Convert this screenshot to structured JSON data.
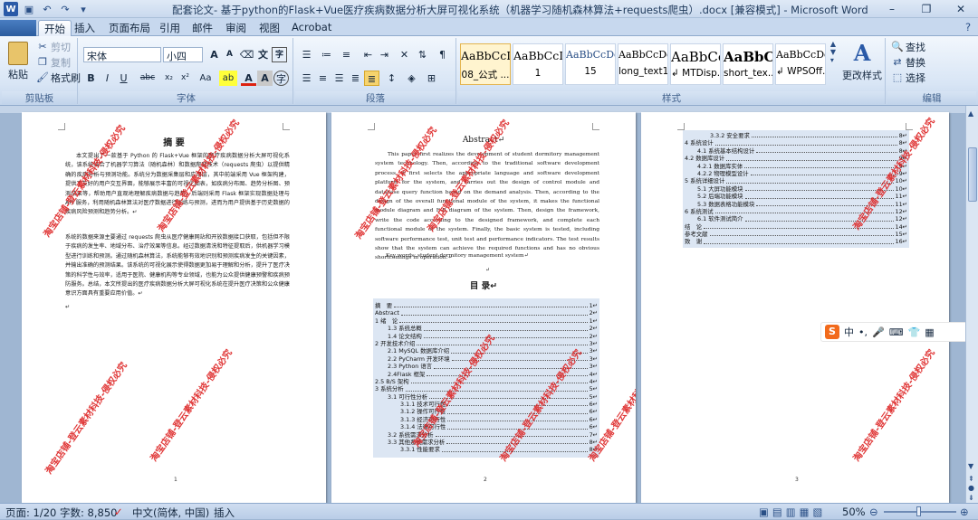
{
  "window": {
    "title": "配套论文- 基于python的Flask+Vue医疗疾病数据分析大屏可视化系统（机器学习随机森林算法+requests爬虫）.docx [兼容模式] - Microsoft Word",
    "minimize": "–",
    "restore": "❐",
    "close": "✕"
  },
  "qat": {
    "undo": "↶",
    "redo": "↷",
    "save": "💾",
    "more": "▾"
  },
  "tabs": [
    "开始",
    "插入",
    "页面布局",
    "引用",
    "邮件",
    "审阅",
    "视图",
    "Acrobat"
  ],
  "clipboard": {
    "paste": "粘贴",
    "cut": "剪切",
    "copy": "复制",
    "painter": "格式刷",
    "label": "剪贴板"
  },
  "font": {
    "name": "宋体",
    "size": "小四",
    "grow": "A",
    "shrink": "A",
    "label": "字体",
    "b": "B",
    "i": "I",
    "u": "U",
    "abc": "abc",
    "x2": "x²",
    "x_2": "x₂",
    "aa": "Aa",
    "hl": "ab",
    "fc": "A",
    "wen": "文",
    "a_circle": "A",
    "zi": "字"
  },
  "paragraph": {
    "label": "段落"
  },
  "styles": {
    "label": "样式",
    "items": [
      {
        "preview": "AaBbCcI",
        "name": "08_公式 ..."
      },
      {
        "preview": "AaBbCcI",
        "name": "1"
      },
      {
        "preview": "AaBbCcDdI",
        "name": "15"
      },
      {
        "preview": "AaBbCcDd",
        "name": "long_text1"
      },
      {
        "preview": "AaBbCc",
        "name": "↲ MTDisp..."
      },
      {
        "preview": "AaBbC",
        "name": "short_tex..."
      },
      {
        "preview": "AaBbCcDd",
        "name": "↲ WPSOff..."
      }
    ],
    "change": "更改样式"
  },
  "editing": {
    "find": "查找",
    "replace": "替换",
    "select": "选择",
    "label": "编辑"
  },
  "page1": {
    "heading": "摘  要",
    "para1": "本文提出了一款基于 Python 的 Flask+Vue 框架的医疗疾病数据分析大屏可视化系统，该系统结合了机器学习算法（随机森林）和数据爬取技术（requests 爬虫）以提供精确的疾病分析与预测功能。系统分为数据采集层和应用层，其中前端采用 Vue 框架构建，提供了友好的用户交互界面，能够展示丰富的可视化图表，如疾病分布图、趋势分析图、预测结果等，帮助用户直观地理解疾病数据与趋势。后端则采用 Flask 框架实现数据处理与 API 服务，利用随机森林算法对医疗数据进行训练与预测，进而为用户提供基于历史数据的疾病风险预测和趋势分析。↵",
    "para2": "系统的数据来源主要通过 requests 爬虫从医疗健康网站和开放数据接口获取，包括但不限于疾病的发生率、地域分布、治疗效果等信息。经过数据清洗和特征提取后，供机器学习模型进行训练和预测。通过随机森林算法，系统能够有效地识别和预测疾病发生的关键因素，并输出准确的预测结果。该系统的可视化展示使得数据更加易于理解和分析，提升了医疗决策的科学性与效率，适用于医院、健康机构等专业领域，也能为公众提供健康预警和疾病预防服务。总结，本文所提出的医疗疾病数据分析大屏可视化系统在提升医疗决策和公众健康意识方面具有重要应用价值。↵",
    "para3": "↵",
    "footer": "1"
  },
  "page2": {
    "heading": "Abstract↵",
    "body": "This paper first realizes the development of student dormitory management system technology. Then, according to the traditional software development process, it first selects the appropriate language and software development platform for the system, and carries out the design of control module and database query function based on the demand analysis. Then, according to the design of the overall functional module of the system, it makes the functional module diagram and E-R diagram of the system. Then, design the framework, write the code according to the designed framework, and complete each functional module of the system. Finally, the basic system is tested, including software performance test, unit test and performance indicators. The test results show that the system can achieve the required functions and has no obvious shortcomings in operation.↵",
    "keywords": "Key words: student dormitory management system↵",
    "blank": "↵",
    "toc_title": "目  录↵",
    "toc": [
      {
        "t": "摘　要",
        "n": "1",
        "i": 0
      },
      {
        "t": "Abstract",
        "n": "2",
        "i": 0
      },
      {
        "t": "1 绪　论",
        "n": "1",
        "i": 0
      },
      {
        "t": "1.3 系统总概",
        "n": "2",
        "i": 1
      },
      {
        "t": "1.4 论文结构",
        "n": "2",
        "i": 1
      },
      {
        "t": "2 开发技术介绍",
        "n": "3",
        "i": 0
      },
      {
        "t": "2.1 MySQL 数据库介绍",
        "n": "3",
        "i": 1
      },
      {
        "t": "2.2 PyCharm 开发环境",
        "n": "3",
        "i": 1
      },
      {
        "t": "2.3 Python 语言",
        "n": "3",
        "i": 1
      },
      {
        "t": "2.4Flask 框架",
        "n": "4",
        "i": 1
      },
      {
        "t": "2.5 B/S 架构",
        "n": "4",
        "i": 0
      },
      {
        "t": "3 系统分析",
        "n": "5",
        "i": 0
      },
      {
        "t": "3.1 可行性分析",
        "n": "5",
        "i": 1
      },
      {
        "t": "3.1.1 技术可行性",
        "n": "6",
        "i": 2
      },
      {
        "t": "3.1.2 操作可行性",
        "n": "6",
        "i": 2
      },
      {
        "t": "3.1.3 经济可行性",
        "n": "6",
        "i": 2
      },
      {
        "t": "3.1.4 法律可行性",
        "n": "6",
        "i": 2
      },
      {
        "t": "3.2 系统需求分析",
        "n": "7",
        "i": 1
      },
      {
        "t": "3.3 其他系统需求分析",
        "n": "8",
        "i": 1
      },
      {
        "t": "3.3.1 性能要求",
        "n": "8",
        "i": 2
      }
    ],
    "footer": "2"
  },
  "page3": {
    "toc": [
      {
        "t": "3.3.2 安全要求",
        "n": "8",
        "i": 2
      },
      {
        "t": "4 系统设计",
        "n": "8",
        "i": 0
      },
      {
        "t": "4.1 系统基本结构设计",
        "n": "8",
        "i": 1
      },
      {
        "t": "4.2 数据库设计",
        "n": "9",
        "i": 0
      },
      {
        "t": "4.2.1 数据库实体",
        "n": "9",
        "i": 1
      },
      {
        "t": "4.2.2 物理模型设计",
        "n": "9",
        "i": 1
      },
      {
        "t": "5 系统详细设计",
        "n": "10",
        "i": 0
      },
      {
        "t": "5.1 大屏功能模块",
        "n": "10",
        "i": 1
      },
      {
        "t": "5.2 后端功能模块",
        "n": "11",
        "i": 1
      },
      {
        "t": "5.3 数据表格功能模块",
        "n": "11",
        "i": 1
      },
      {
        "t": "6 系统测试",
        "n": "12",
        "i": 0
      },
      {
        "t": "6.1 软件测试简介",
        "n": "12",
        "i": 1
      },
      {
        "t": "结　论",
        "n": "14",
        "i": 0
      },
      {
        "t": "参考文献",
        "n": "15",
        "i": 0
      },
      {
        "t": "致　谢",
        "n": "16",
        "i": 0
      }
    ],
    "footer": "3"
  },
  "watermark": "淘宝店铺-登云素材科技-侵权必究",
  "ime": {
    "logo": "S",
    "lang": "中",
    "punct": "•,",
    "mic": "🎤",
    "kbd": "⌨",
    "shirt": "👕",
    "grid": "▦"
  },
  "status": {
    "page": "页面: 1/20",
    "words": "字数: 8,850",
    "lang": "中文(简体, 中国)",
    "mode": "插入",
    "zoom": "50%",
    "zoom_minus": "⊖",
    "zoom_plus": "⊕"
  }
}
